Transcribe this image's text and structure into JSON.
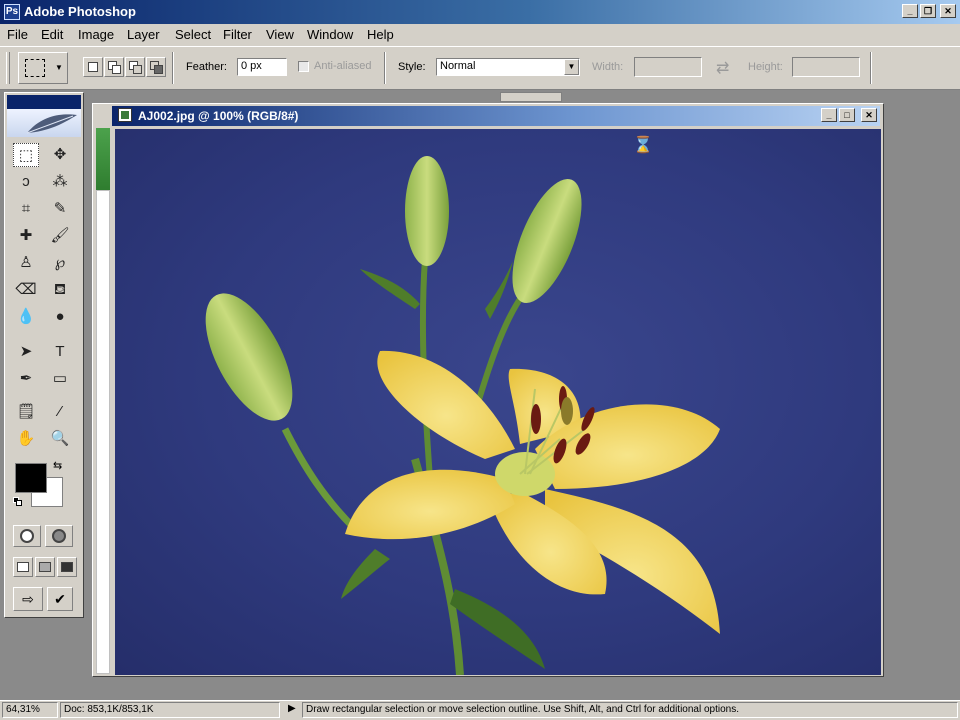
{
  "app": {
    "title": "Adobe Photoshop",
    "icon_text": "Ps",
    "window_controls": {
      "minimize": "_",
      "restore": "❐",
      "close": "✕"
    }
  },
  "menu": {
    "items": [
      "File",
      "Edit",
      "Image",
      "Layer",
      "Select",
      "Filter",
      "View",
      "Window",
      "Help"
    ]
  },
  "options": {
    "feather_label": "Feather:",
    "feather_value": "0 px",
    "anti_aliased_label": "Anti-aliased",
    "style_label": "Style:",
    "style_value": "Normal",
    "width_label": "Width:",
    "height_label": "Height:",
    "swap_icon": "⇄"
  },
  "toolbox": {
    "tools": [
      {
        "name": "marquee-tool",
        "glyph": "⬚"
      },
      {
        "name": "move-tool",
        "glyph": "✥"
      },
      {
        "name": "lasso-tool",
        "glyph": "ↄ"
      },
      {
        "name": "magic-wand-tool",
        "glyph": "⁂"
      },
      {
        "name": "crop-tool",
        "glyph": "⌗"
      },
      {
        "name": "slice-tool",
        "glyph": "✎"
      },
      {
        "name": "healing-brush-tool",
        "glyph": "✚"
      },
      {
        "name": "brush-tool",
        "glyph": "🖌"
      },
      {
        "name": "clone-stamp-tool",
        "glyph": "♙"
      },
      {
        "name": "history-brush-tool",
        "glyph": "℘"
      },
      {
        "name": "eraser-tool",
        "glyph": "⌫"
      },
      {
        "name": "paint-bucket-tool",
        "glyph": "⛾"
      },
      {
        "name": "blur-tool",
        "glyph": "💧"
      },
      {
        "name": "dodge-tool",
        "glyph": "●"
      },
      {
        "name": "path-selection-tool",
        "glyph": "➤"
      },
      {
        "name": "type-tool",
        "glyph": "T"
      },
      {
        "name": "pen-tool",
        "glyph": "✒"
      },
      {
        "name": "shape-tool",
        "glyph": "▭"
      },
      {
        "name": "notes-tool",
        "glyph": "🗒"
      },
      {
        "name": "eyedropper-tool",
        "glyph": "⁄"
      },
      {
        "name": "hand-tool",
        "glyph": "✋"
      },
      {
        "name": "zoom-tool",
        "glyph": "🔍"
      }
    ],
    "foreground_color": "#000000",
    "background_color": "#ffffff"
  },
  "document": {
    "title": "AJ002.jpg @ 100% (RGB/8#)",
    "controls": {
      "minimize": "_",
      "maximize": "□",
      "close": "✕"
    },
    "busy_cursor": "⌛"
  },
  "status": {
    "zoom": "64,31%",
    "doc_info": "Doc: 853,1K/853,1K",
    "hint": "Draw rectangular selection or move selection outline.  Use Shift, Alt, and Ctrl for additional options.",
    "arrow": "▶"
  },
  "colors": {
    "titlebar_dark": "#0a246a",
    "canvas_blue": "#2f3a7e",
    "petal_yellow": "#f2d45a",
    "stem_green": "#6f9a3a"
  }
}
